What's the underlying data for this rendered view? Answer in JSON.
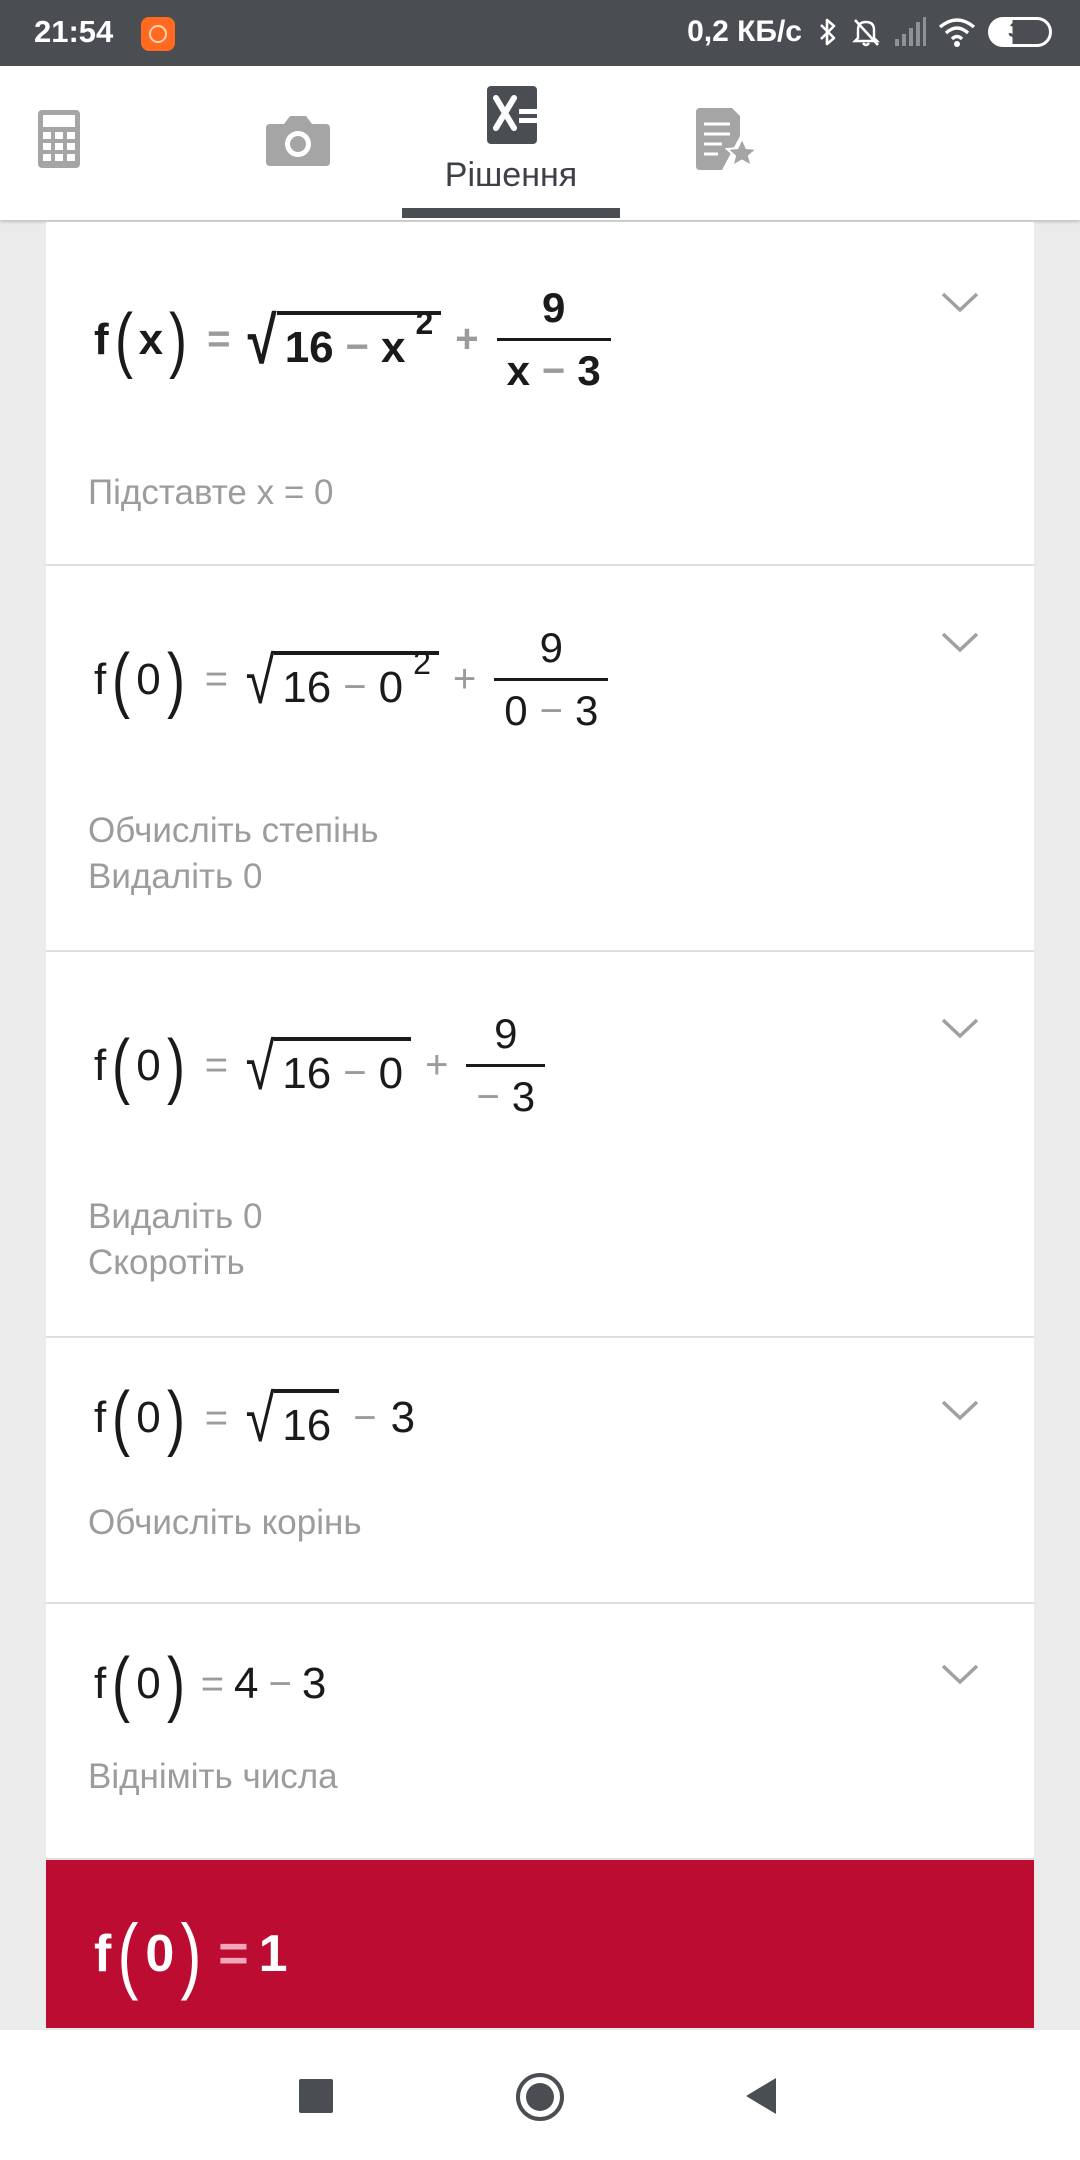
{
  "status_bar": {
    "time": "21:54",
    "speed": "0,2 КБ/с",
    "battery": "37",
    "icons": [
      "app-notification-icon",
      "bluetooth-icon",
      "mute-bell-icon",
      "signal-icon",
      "wifi-icon",
      "battery-icon"
    ]
  },
  "top_bar": {
    "tabs": [
      {
        "icon": "calculator-icon"
      },
      {
        "icon": "camera-icon"
      },
      {
        "icon": "solution-icon",
        "label": "Рішення",
        "active": true
      },
      {
        "icon": "favorites-icon"
      }
    ]
  },
  "steps": [
    {
      "lhs_fn": "f",
      "lhs_arg": "x",
      "eq": "=",
      "r_a": "16",
      "r_op": "−",
      "r_b": "x",
      "r_exp": "2",
      "plus": "+",
      "f_num": "9",
      "f_den_a": "x",
      "f_den_op": "−",
      "f_den_b": "3",
      "descriptions": [
        "Підставте x = 0"
      ]
    },
    {
      "lhs_fn": "f",
      "lhs_arg": "0",
      "eq": "=",
      "r_a": "16",
      "r_op": "−",
      "r_b": "0",
      "r_exp": "2",
      "plus": "+",
      "f_num": "9",
      "f_den_a": "0",
      "f_den_op": "−",
      "f_den_b": "3",
      "descriptions": [
        "Обчисліть степінь",
        "Видаліть 0"
      ]
    },
    {
      "lhs_fn": "f",
      "lhs_arg": "0",
      "eq": "=",
      "r_a": "16",
      "r_op": "−",
      "r_b": "0",
      "plus": "+",
      "f_num": "9",
      "f_den_op": "−",
      "f_den_b": "3",
      "descriptions": [
        "Видаліть 0",
        "Скоротіть"
      ]
    },
    {
      "lhs_fn": "f",
      "lhs_arg": "0",
      "eq": "=",
      "r_a": "16",
      "tail_op": "−",
      "tail_b": "3",
      "descriptions": [
        "Обчисліть корінь"
      ]
    },
    {
      "lhs_fn": "f",
      "lhs_arg": "0",
      "eq": "=",
      "a": "4",
      "op": "−",
      "b": "3",
      "descriptions": [
        "Відніміть числа"
      ]
    }
  ],
  "result": {
    "lhs_fn": "f",
    "lhs_arg": "0",
    "eq": "=",
    "value": "1"
  },
  "colors": {
    "status_bar": "#4a4d52",
    "result_bg": "#bd0c32",
    "description_text": "#9c9c9c"
  },
  "nav_bar": {
    "icons": [
      "recents-square-icon",
      "home-circle-icon",
      "back-triangle-icon"
    ]
  }
}
